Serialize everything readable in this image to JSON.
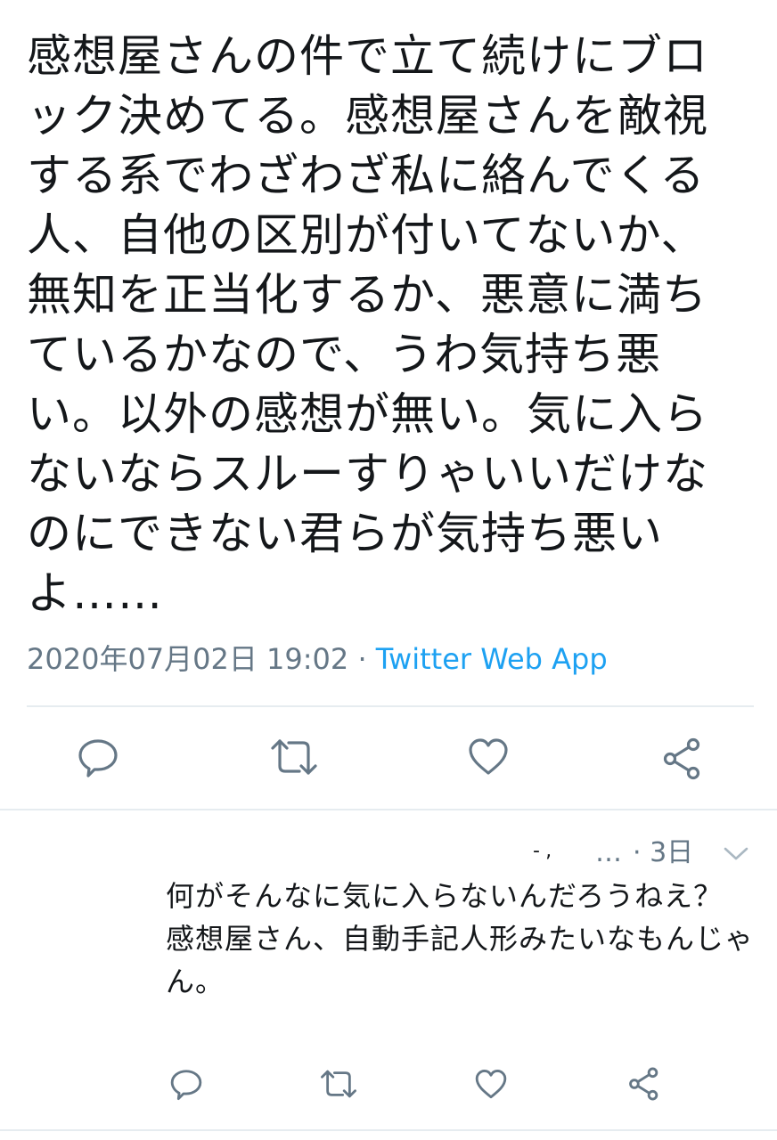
{
  "tweet": {
    "text": "感想屋さんの件で立て続けにブロック決めてる。感想屋さんを敵視する系でわざわざ私に絡んでくる人、自他の区別が付いてないか、無知を正当化するか、悪意に満ちているかなので、うわ気持ち悪い。以外の感想が無い。気に入らないならスルーすりゃいいだけなのにできない君らが気持ち悪いよ……",
    "date": "2020年07月02日 19:02",
    "separator": "·",
    "source": "Twitter Web App"
  },
  "tweet_actions": {
    "reply_icon": "reply-bubble-icon",
    "retweet_icon": "retweet-icon",
    "like_icon": "heart-icon",
    "share_icon": "share-icon"
  },
  "reply": {
    "handle": "-‚",
    "ellipsis": "…",
    "separator": "·",
    "time": "3日",
    "menu_icon": "chevron-down-icon",
    "text": "何がそんなに気に入らないんだろうねえ？\n感想屋さん、自動手記人形みたいなもんじゃん。"
  },
  "reply_actions": {
    "reply_icon": "reply-bubble-icon",
    "retweet_icon": "retweet-icon",
    "like_icon": "heart-icon",
    "share_icon": "share-icon"
  },
  "colors": {
    "text": "#14171a",
    "secondary": "#657786",
    "link": "#1da1f2",
    "divider": "#e6ecf0"
  }
}
